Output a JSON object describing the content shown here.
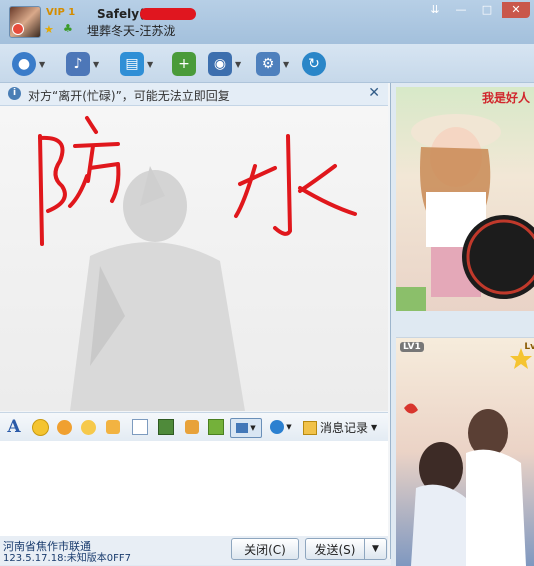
{
  "title_bar": {
    "vip": "VIP 1",
    "nickname": "Safely(",
    "signature": "埋葬冬天-汪苏泷",
    "window_buttons": [
      "⇊",
      "—",
      "□",
      "✕"
    ]
  },
  "toolbar": {
    "buttons": [
      {
        "icon": "video-call-icon",
        "color": "#3a7cc9"
      },
      {
        "icon": "voice-call-icon",
        "color": "#4d77b8"
      },
      {
        "icon": "send-file-icon",
        "color": "#2f8fd6"
      },
      {
        "icon": "create-group-icon",
        "color": "#4a9b3a"
      },
      {
        "icon": "remote-assist-icon",
        "color": "#3d6fae"
      },
      {
        "icon": "app-icon",
        "color": "#4e80bd"
      },
      {
        "icon": "share-icon",
        "color": "#2a86c8"
      }
    ]
  },
  "notice": {
    "text": "对方“离开(忙碌)”，可能无法立即回复",
    "close": "✕"
  },
  "message_area": {
    "handwritten_left": "防",
    "handwritten_right": "水"
  },
  "format_bar": {
    "font_button": "A",
    "history_label": "消息记录"
  },
  "footer": {
    "location": "河南省焦作市联通",
    "version": "123.5.17.18:未知版本0FF7",
    "close_button": "关闭(C)",
    "send_button": "发送(S)"
  },
  "ads": {
    "ad1_tagline": "我是好人",
    "ad2_badge_left": "LV1",
    "ad2_badge_right": "Lv"
  }
}
